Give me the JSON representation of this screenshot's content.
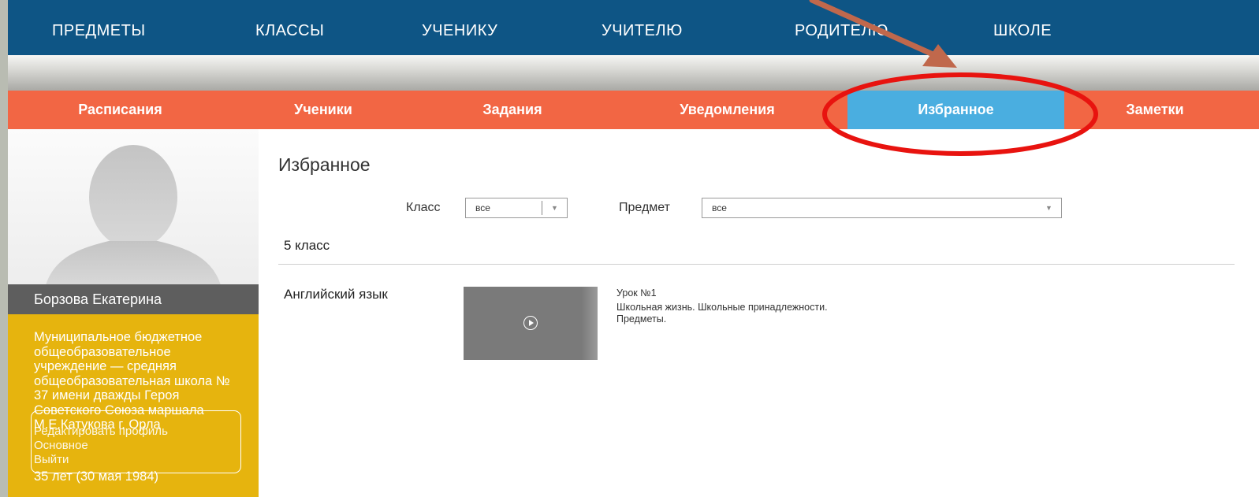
{
  "topnav": {
    "items": [
      {
        "label": "ПРЕДМЕТЫ"
      },
      {
        "label": "КЛАССЫ"
      },
      {
        "label": "УЧЕНИКУ"
      },
      {
        "label": "УЧИТЕЛЮ"
      },
      {
        "label": "РОДИТЕЛЮ"
      },
      {
        "label": "ШКОЛЕ"
      }
    ]
  },
  "subnav": {
    "tabs": [
      {
        "label": "Расписания"
      },
      {
        "label": "Ученики"
      },
      {
        "label": "Задания"
      },
      {
        "label": "Уведомления"
      },
      {
        "label": "Избранное"
      },
      {
        "label": "Заметки"
      }
    ],
    "active": "Избранное"
  },
  "profile": {
    "name": "Борзова Екатерина",
    "school": "Муниципальное бюджетное общеобразовательное учреждение — средняя общеобразовательная школа № 37 имени дважды Героя Советского Союза маршала М.Е.Катукова г. Орла",
    "age": "35 лет (30 мая 1984)",
    "box_text_1": "Редактировать профиль",
    "box_text_2": "Основное",
    "box_text_3": "Выйти"
  },
  "main": {
    "title": "Избранное",
    "filters": {
      "class_label": "Класс",
      "class_value": "все",
      "subject_label": "Предмет",
      "subject_value": "все"
    },
    "class_heading": "5 класс",
    "entries": [
      {
        "subject": "Английский язык",
        "lesson_title": "Урок №1",
        "lesson_desc_1": "Школьная жизнь. Школьные принадлежности.",
        "lesson_desc_2": "Предметы."
      }
    ]
  },
  "colors": {
    "topnav_bg": "#0e5585",
    "subnav_bg": "#f26644",
    "active_tab_bg": "#4aaee0",
    "school_panel_bg": "#e6b40e",
    "profile_name_bg": "#5e5e5e",
    "annotation_ellipse": "#e8130f",
    "annotation_arrow": "#c0684c"
  },
  "icons": {
    "avatar": "user-silhouette-icon",
    "play": "play-circle-icon",
    "caret": "chevron-down-icon"
  }
}
